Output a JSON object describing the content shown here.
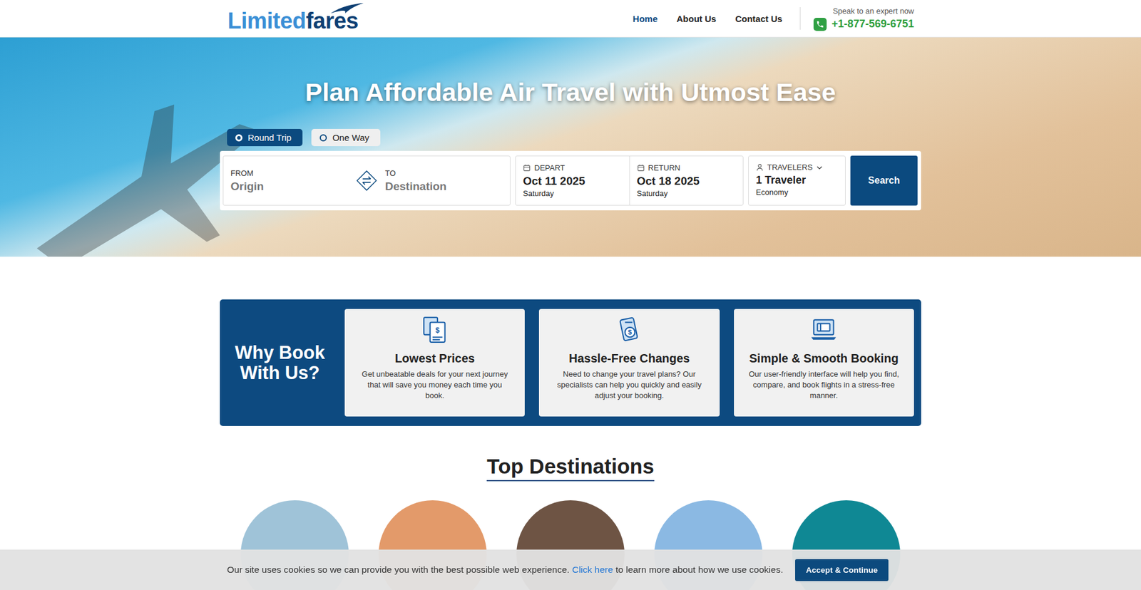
{
  "header": {
    "logo": {
      "light": "Limited",
      "bold": "fares"
    },
    "nav": [
      {
        "label": "Home",
        "selected": true
      },
      {
        "label": "About Us",
        "selected": false
      },
      {
        "label": "Contact Us",
        "selected": false
      }
    ],
    "contact": {
      "caption": "Speak to an expert now",
      "phone": "+1-877-569-6751"
    }
  },
  "hero": {
    "title": "Plan Affordable Air Travel with Utmost Ease",
    "tripTypes": [
      {
        "label": "Round Trip",
        "selected": true
      },
      {
        "label": "One Way",
        "selected": false
      }
    ],
    "search": {
      "from": {
        "label": "FROM",
        "placeholder": "Origin"
      },
      "to": {
        "label": "TO",
        "placeholder": "Destination"
      },
      "depart": {
        "label": "DEPART",
        "date": "Oct 11 2025",
        "day": "Saturday"
      },
      "return": {
        "label": "RETURN",
        "date": "Oct 18 2025",
        "day": "Saturday"
      },
      "travelers": {
        "label": "TRAVELERS",
        "value": "1 Traveler",
        "cabin": "Economy"
      },
      "button": "Search"
    }
  },
  "why": {
    "title": "Why Book With Us?",
    "cards": [
      {
        "title": "Lowest Prices",
        "text": "Get unbeatable deals for your next journey that will save you money each time you book."
      },
      {
        "title": "Hassle-Free Changes",
        "text": "Need to change your travel plans? Our specialists can help you quickly and easily adjust your booking."
      },
      {
        "title": "Simple & Smooth Booking",
        "text": "Our user-friendly interface will help you find, compare, and book flights in a stress-free manner."
      }
    ]
  },
  "destinations": {
    "title": "Top Destinations",
    "items": [
      {
        "color": "#9fc3d8"
      },
      {
        "color": "#e39a6a"
      },
      {
        "color": "#6e5444"
      },
      {
        "color": "#8bb9e3"
      },
      {
        "color": "#0f8894"
      }
    ]
  },
  "cookie": {
    "text": "Our site uses cookies so we can provide you with the best possible web experience.",
    "link": "Click here",
    "rest": "to learn more about how we use cookies.",
    "button": "Accept & Continue"
  }
}
